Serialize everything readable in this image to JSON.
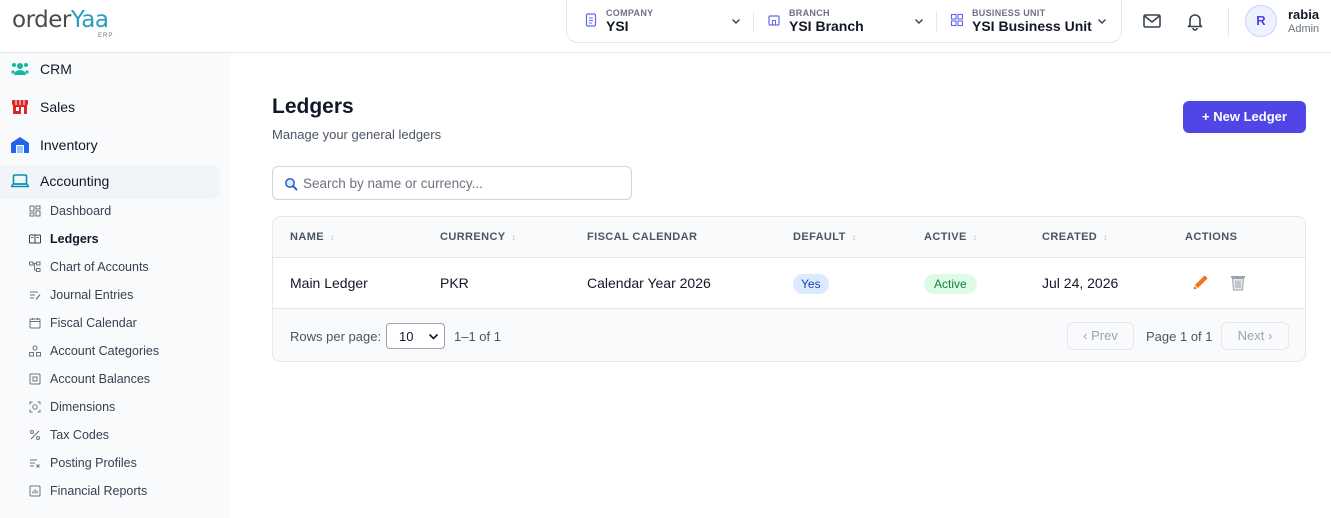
{
  "brand": {
    "name_part1": "order",
    "name_part2": "Yaa",
    "tagline": "ERP"
  },
  "selectors": [
    {
      "caption": "COMPANY",
      "value": "YSI",
      "icon": "document-icon"
    },
    {
      "caption": "BRANCH",
      "value": "YSI Branch",
      "icon": "storefront-icon"
    },
    {
      "caption": "BUSINESS UNIT",
      "value": "YSI Business Unit",
      "icon": "grid-icon"
    }
  ],
  "header_icons": [
    "mail-icon",
    "bell-icon"
  ],
  "user": {
    "initial": "R",
    "name": "rabia",
    "role": "Admin"
  },
  "sidebar": {
    "modules": [
      {
        "label": "CRM",
        "icon": "crm-people-icon",
        "color": "#14b8a6"
      },
      {
        "label": "Sales",
        "icon": "shop-icon",
        "color": "#dc2626"
      },
      {
        "label": "Inventory",
        "icon": "warehouse-icon",
        "color": "#2563eb"
      },
      {
        "label": "Accounting",
        "icon": "laptop-icon",
        "color": "#0891b2",
        "active": true
      }
    ],
    "accounting_items": [
      {
        "label": "Dashboard",
        "icon": "dashboard-icon"
      },
      {
        "label": "Ledgers",
        "icon": "book-icon",
        "current": true
      },
      {
        "label": "Chart of Accounts",
        "icon": "tree-icon"
      },
      {
        "label": "Journal Entries",
        "icon": "journal-icon"
      },
      {
        "label": "Fiscal Calendar",
        "icon": "calendar-icon"
      },
      {
        "label": "Account Categories",
        "icon": "categories-icon"
      },
      {
        "label": "Account Balances",
        "icon": "balance-icon"
      },
      {
        "label": "Dimensions",
        "icon": "dimensions-icon"
      },
      {
        "label": "Tax Codes",
        "icon": "percent-icon"
      },
      {
        "label": "Posting Profiles",
        "icon": "posting-icon"
      },
      {
        "label": "Financial Reports",
        "icon": "report-icon"
      }
    ]
  },
  "page": {
    "title": "Ledgers",
    "subtitle": "Manage your general ledgers",
    "new_button": "+ New Ledger",
    "search_placeholder": "Search by name or currency..."
  },
  "table": {
    "columns": [
      "NAME",
      "CURRENCY",
      "FISCAL CALENDAR",
      "DEFAULT",
      "ACTIVE",
      "CREATED",
      "ACTIONS"
    ],
    "sortable": [
      true,
      true,
      false,
      true,
      true,
      true,
      false
    ],
    "rows": [
      {
        "name": "Main Ledger",
        "currency": "PKR",
        "fiscal_calendar": "Calendar Year 2026",
        "default": "Yes",
        "active": "Active",
        "created": "Jul 24, 2026"
      }
    ]
  },
  "pagination": {
    "rows_per_page_label": "Rows per page:",
    "rows_per_page": "10",
    "range": "1–1 of 1",
    "prev": "‹ Prev",
    "page_info": "Page 1 of 1",
    "next": "Next ›"
  },
  "colors": {
    "primary": "#4f46e5",
    "accent": "#2c9bc4",
    "edit": "#ea580c"
  }
}
